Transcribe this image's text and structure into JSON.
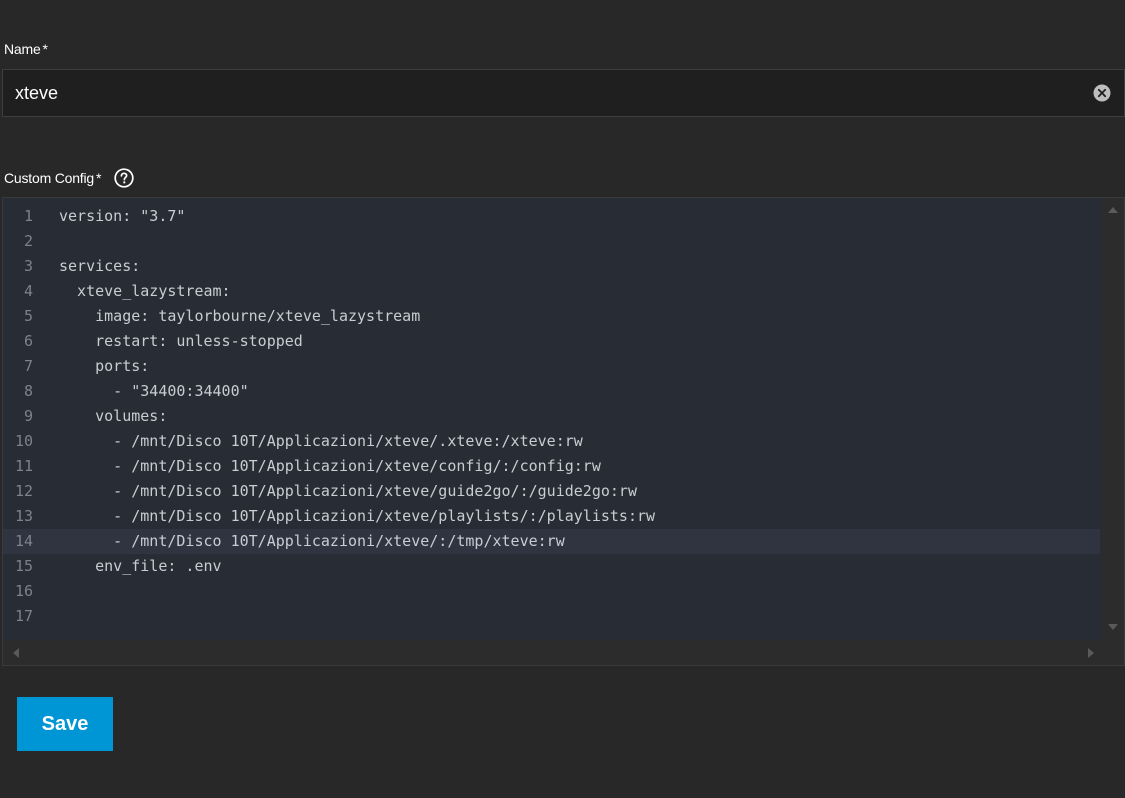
{
  "name_field": {
    "label": "Name",
    "required_mark": "*",
    "value": "xteve"
  },
  "config_field": {
    "label": "Custom Config",
    "required_mark": "*",
    "active_line": 14,
    "lines": [
      {
        "number": "1",
        "text": "version: \"3.7\""
      },
      {
        "number": "2",
        "text": ""
      },
      {
        "number": "3",
        "text": "services:"
      },
      {
        "number": "4",
        "text": "  xteve_lazystream:"
      },
      {
        "number": "5",
        "text": "    image: taylorbourne/xteve_lazystream"
      },
      {
        "number": "6",
        "text": "    restart: unless-stopped"
      },
      {
        "number": "7",
        "text": "    ports:"
      },
      {
        "number": "8",
        "text": "      - \"34400:34400\""
      },
      {
        "number": "9",
        "text": "    volumes:"
      },
      {
        "number": "10",
        "text": "      - /mnt/Disco 10T/Applicazioni/xteve/.xteve:/xteve:rw"
      },
      {
        "number": "11",
        "text": "      - /mnt/Disco 10T/Applicazioni/xteve/config/:/config:rw"
      },
      {
        "number": "12",
        "text": "      - /mnt/Disco 10T/Applicazioni/xteve/guide2go/:/guide2go:rw"
      },
      {
        "number": "13",
        "text": "      - /mnt/Disco 10T/Applicazioni/xteve/playlists/:/playlists:rw"
      },
      {
        "number": "14",
        "text": "      - /mnt/Disco 10T/Applicazioni/xteve/:/tmp/xteve:rw"
      },
      {
        "number": "15",
        "text": "    env_file: .env"
      },
      {
        "number": "16",
        "text": ""
      },
      {
        "number": "17",
        "text": ""
      }
    ]
  },
  "actions": {
    "save_label": "Save"
  },
  "colors": {
    "accent": "#0095d5",
    "background": "#282828",
    "editor_background": "#282c34"
  }
}
